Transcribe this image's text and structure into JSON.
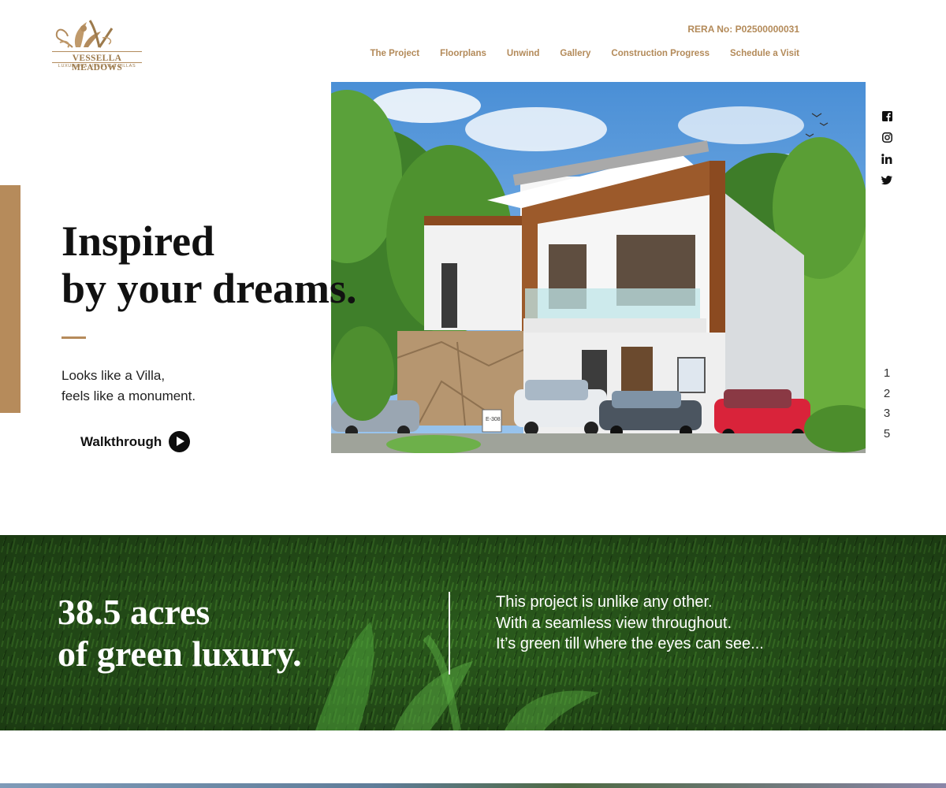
{
  "logo": {
    "name": "VESSELLA MEADOWS",
    "tagline": "LUXURIOUS LIFESTYLE VILLAS"
  },
  "header": {
    "rera": "RERA No: P02500000031",
    "nav": [
      "The Project",
      "Floorplans",
      "Unwind",
      "Gallery",
      "Construction Progress",
      "Schedule a Visit"
    ]
  },
  "hero": {
    "heading_line1": "Inspired",
    "heading_line2": "by your dreams.",
    "sub_line1": "Looks like a Villa,",
    "sub_line2": "feels like a monument.",
    "walkthrough": "Walkthrough",
    "sign_text": "E-308"
  },
  "social_icons": [
    "facebook-icon",
    "instagram-icon",
    "linkedin-icon",
    "twitter-icon"
  ],
  "pager": [
    "1",
    "2",
    "3",
    "5"
  ],
  "green_band": {
    "heading_line1": "38.5 acres",
    "heading_line2": "of green luxury.",
    "text_line1": "This project is unlike any other.",
    "text_line2": "With a seamless view throughout.",
    "text_line3": "It’s green till where the eyes can see..."
  },
  "colors": {
    "accent": "#b68b5b",
    "nav": "#b38a59",
    "green": "#2b5a1c"
  }
}
